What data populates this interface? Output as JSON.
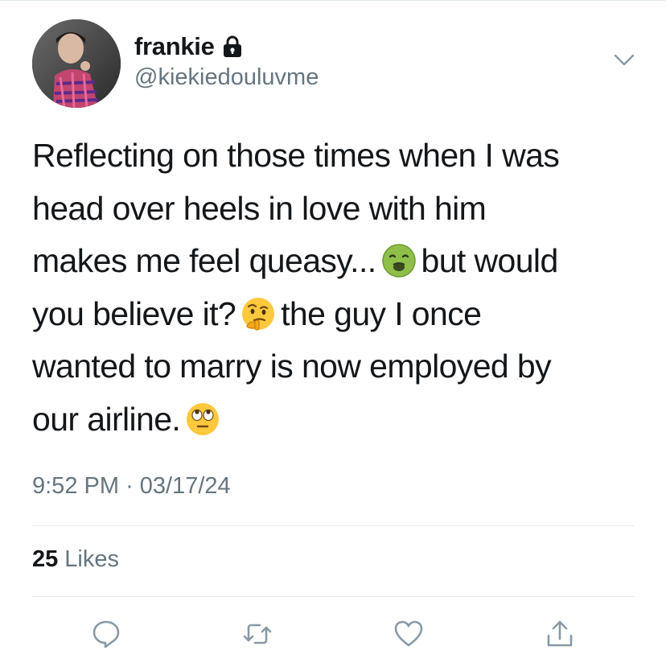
{
  "author": {
    "display_name": "frankie",
    "handle": "@kiekiedouluvme",
    "protected_icon": "lock-icon",
    "avatar": "profile-photo"
  },
  "menu_icon": "chevron-down-icon",
  "tweet": {
    "line1": "Reflecting on those times when I was",
    "line2": "head over heels in love with him",
    "line3_a": "makes me feel queasy...",
    "line3_b": "but would",
    "line4_a": "you believe it?",
    "line4_b": "the guy I once",
    "line5": "wanted to marry is now employed by",
    "line6": "our airline.",
    "emojis": [
      "nauseated-face-emoji",
      "thinking-face-emoji",
      "eye-roll-emoji"
    ]
  },
  "timestamp": {
    "time": "9:52 PM",
    "separator": "·",
    "date": "03/17/24"
  },
  "likes": {
    "count": "25",
    "label": "Likes"
  },
  "actions": [
    "reply-icon",
    "retweet-icon",
    "like-icon",
    "share-icon"
  ],
  "colors": {
    "text": "#14171a",
    "secondary": "#66757f",
    "divider": "#e1e6ea",
    "icon": "#8899a6"
  }
}
